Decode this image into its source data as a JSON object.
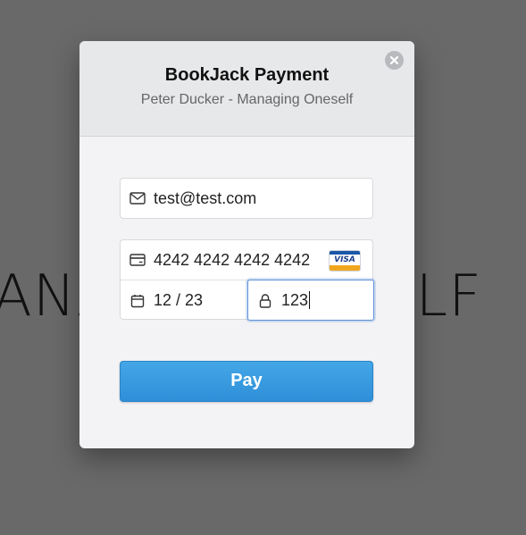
{
  "background": {
    "left_text": "ANA",
    "right_text": "ELF"
  },
  "modal": {
    "title": "BookJack Payment",
    "subtitle": "Peter Ducker - Managing Oneself",
    "close_icon": "close-circle-icon"
  },
  "form": {
    "email": {
      "value": "test@test.com",
      "icon": "envelope-icon"
    },
    "card_number": {
      "value": "4242 4242 4242 4242",
      "icon": "credit-card-icon",
      "brand": "VISA"
    },
    "expiry": {
      "value": "12 / 23",
      "icon": "calendar-icon"
    },
    "cvc": {
      "value": "123",
      "icon": "lock-icon",
      "focused": true
    }
  },
  "pay_button": {
    "label": "Pay",
    "color": "#3a9de0"
  },
  "colors": {
    "overlay": "#696969",
    "focus": "#5b8fd6"
  }
}
